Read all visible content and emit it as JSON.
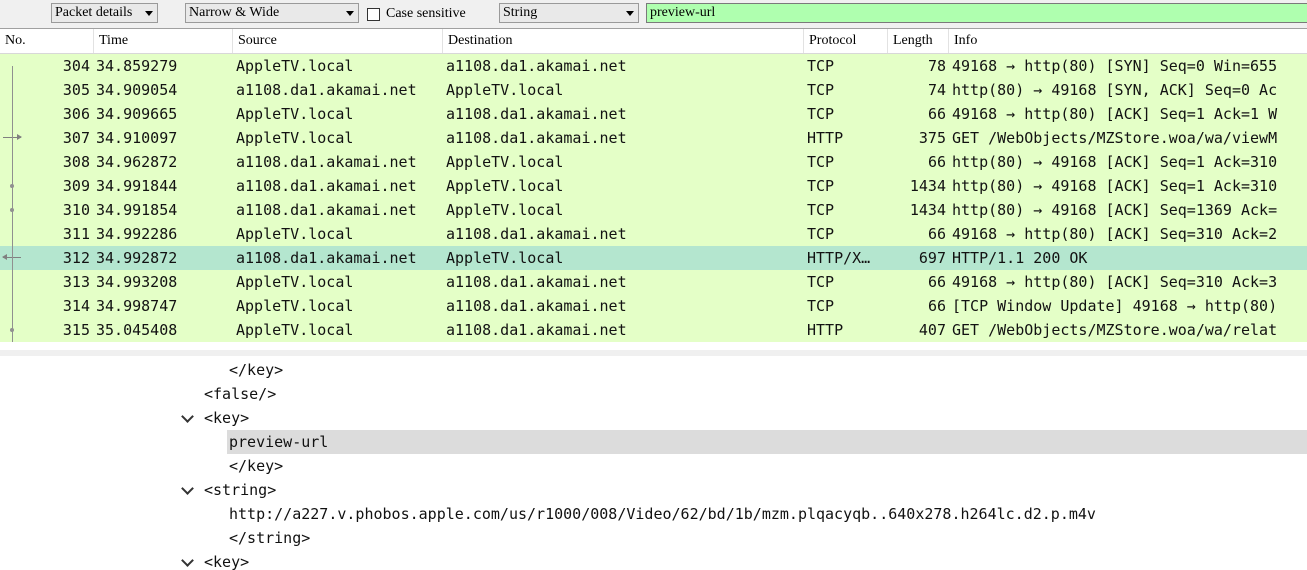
{
  "find_bar": {
    "search_in": "Packet details",
    "char_width": "Narrow & Wide",
    "case_sensitive_label": "Case sensitive",
    "search_type": "String",
    "search_value": "preview-url",
    "search_bg_color": "#afffaf"
  },
  "packet_list": {
    "columns": [
      "No.",
      "Time",
      "Source",
      "Destination",
      "Protocol",
      "Length",
      "Info"
    ],
    "row_color": "#e4ffc7",
    "selected_color": "#b4e6cf",
    "rows": [
      {
        "no": "304",
        "time": "34.859279",
        "src": "AppleTV.local",
        "dst": "a1108.da1.akamai.net",
        "proto": "TCP",
        "len": "78",
        "info": "49168 → http(80) [SYN] Seq=0 Win=655"
      },
      {
        "no": "305",
        "time": "34.909054",
        "src": "a1108.da1.akamai.net",
        "dst": "AppleTV.local",
        "proto": "TCP",
        "len": "74",
        "info": "http(80) → 49168 [SYN, ACK] Seq=0 Ac"
      },
      {
        "no": "306",
        "time": "34.909665",
        "src": "AppleTV.local",
        "dst": "a1108.da1.akamai.net",
        "proto": "TCP",
        "len": "66",
        "info": "49168 → http(80) [ACK] Seq=1 Ack=1 W"
      },
      {
        "no": "307",
        "time": "34.910097",
        "src": "AppleTV.local",
        "dst": "a1108.da1.akamai.net",
        "proto": "HTTP",
        "len": "375",
        "info": "GET /WebObjects/MZStore.woa/wa/viewM"
      },
      {
        "no": "308",
        "time": "34.962872",
        "src": "a1108.da1.akamai.net",
        "dst": "AppleTV.local",
        "proto": "TCP",
        "len": "66",
        "info": "http(80) → 49168 [ACK] Seq=1 Ack=310"
      },
      {
        "no": "309",
        "time": "34.991844",
        "src": "a1108.da1.akamai.net",
        "dst": "AppleTV.local",
        "proto": "TCP",
        "len": "1434",
        "info": "http(80) → 49168 [ACK] Seq=1 Ack=310"
      },
      {
        "no": "310",
        "time": "34.991854",
        "src": "a1108.da1.akamai.net",
        "dst": "AppleTV.local",
        "proto": "TCP",
        "len": "1434",
        "info": "http(80) → 49168 [ACK] Seq=1369 Ack="
      },
      {
        "no": "311",
        "time": "34.992286",
        "src": "AppleTV.local",
        "dst": "a1108.da1.akamai.net",
        "proto": "TCP",
        "len": "66",
        "info": "49168 → http(80) [ACK] Seq=310 Ack=2"
      },
      {
        "no": "312",
        "time": "34.992872",
        "src": "a1108.da1.akamai.net",
        "dst": "AppleTV.local",
        "proto": "HTTP/X…",
        "len": "697",
        "info": "HTTP/1.1 200 OK"
      },
      {
        "no": "313",
        "time": "34.993208",
        "src": "AppleTV.local",
        "dst": "a1108.da1.akamai.net",
        "proto": "TCP",
        "len": "66",
        "info": "49168 → http(80) [ACK] Seq=310 Ack=3"
      },
      {
        "no": "314",
        "time": "34.998747",
        "src": "AppleTV.local",
        "dst": "a1108.da1.akamai.net",
        "proto": "TCP",
        "len": "66",
        "info": "[TCP Window Update] 49168 → http(80)"
      },
      {
        "no": "315",
        "time": "35.045408",
        "src": "AppleTV.local",
        "dst": "a1108.da1.akamai.net",
        "proto": "HTTP",
        "len": "407",
        "info": "GET /WebObjects/MZStore.woa/wa/relat"
      }
    ]
  },
  "details": {
    "lines": [
      {
        "text": "</key>"
      },
      {
        "text": "<false/>"
      },
      {
        "text": "<key>"
      },
      {
        "text": "preview-url"
      },
      {
        "text": "</key>"
      },
      {
        "text": "<string>"
      },
      {
        "text": "http://a227.v.phobos.apple.com/us/r1000/008/Video/62/bd/1b/mzm.plqacyqb..640x278.h264lc.d2.p.m4v"
      },
      {
        "text": "</string>"
      },
      {
        "text": "<key>"
      }
    ]
  }
}
